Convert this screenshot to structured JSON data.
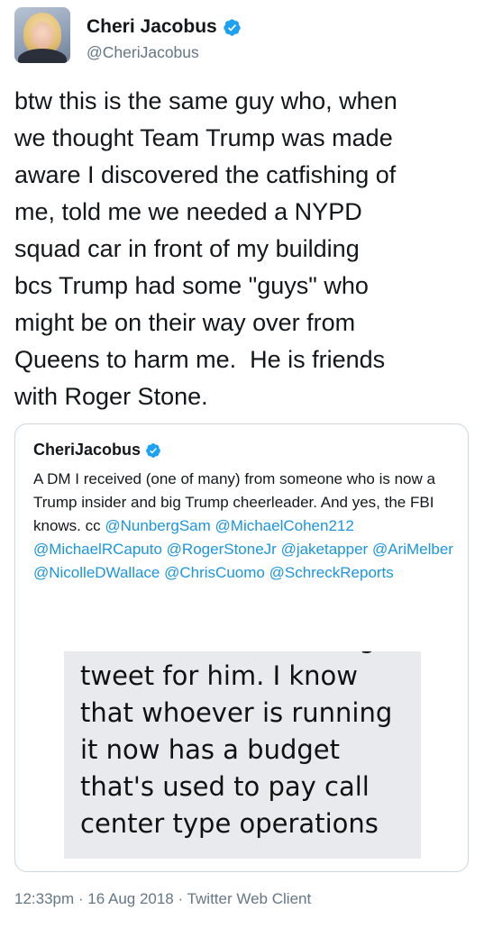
{
  "author": {
    "display_name": "Cheri Jacobus",
    "handle": "@CheriJacobus",
    "verified_icon": "verified-badge-icon",
    "verified_color": "#1da1f2"
  },
  "tweet": {
    "text": "btw this is the same guy who, when\nwe thought Team Trump was made\naware I discovered the catfishing of\nme, told me we needed a NYPD\nsquad car in front of my building\nbcs Trump had some \"guys\" who\nmight be on their way over from\nQueens to harm me.  He is friends\nwith Roger Stone."
  },
  "quoted_tweet": {
    "display_name": "CheriJacobus",
    "text_parts": [
      "A DM I received (one of many) from someone who is now a Trump insider and big Trump cheerleader.  And yes, the FBI knows.  cc "
    ],
    "mentions": [
      "@NunbergSam",
      "@MichaelCohen212",
      "@MichaelRCaputo",
      "@RogerStoneJr",
      "@jaketapper",
      "@AriMelber",
      "@NicolleDWallace",
      "@ChrisCuomo",
      "@SchreckReports"
    ],
    "image_text": "let Stone and Nunberg\ntweet for him. I know\nthat whoever is running\nit now has a budget\nthat's used to pay call\ncenter type operations"
  },
  "footer": {
    "time": "12:33pm",
    "separator": " · ",
    "date": "16 Aug 2018",
    "client": "Twitter Web Client"
  },
  "colors": {
    "text": "#14171a",
    "secondary": "#657786",
    "link": "#1b95e0",
    "border": "#ccd6dd"
  }
}
